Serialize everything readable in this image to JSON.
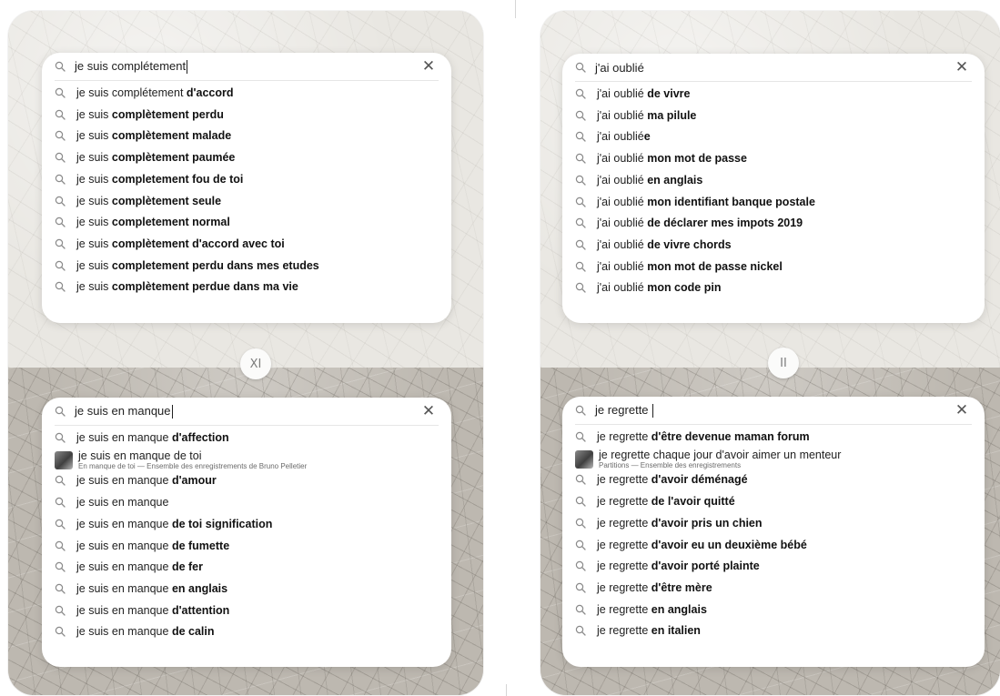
{
  "panels": [
    {
      "numeral": "XI",
      "top": {
        "query": "je suis complétement",
        "caret": true,
        "suggestions": [
          {
            "plain": "je suis complétement ",
            "bold": "d'accord"
          },
          {
            "plain": "je suis ",
            "bold": "complètement perdu"
          },
          {
            "plain": "je suis ",
            "bold": "complètement malade"
          },
          {
            "plain": "je suis ",
            "bold": "complètement paumée"
          },
          {
            "plain": "je suis ",
            "bold": "completement fou de toi"
          },
          {
            "plain": "je suis ",
            "bold": "complètement seule"
          },
          {
            "plain": "je suis ",
            "bold": "completement normal"
          },
          {
            "plain": "je suis ",
            "bold": "complètement d'accord avec toi"
          },
          {
            "plain": "je suis ",
            "bold": "completement perdu dans mes etudes"
          },
          {
            "plain": "je suis ",
            "bold": "complètement perdue dans ma vie"
          }
        ]
      },
      "bottom": {
        "query": "je suis en manque",
        "caret": true,
        "suggestions": [
          {
            "plain": "je suis en manque ",
            "bold": "d'affection"
          },
          {
            "rich": true,
            "title": "je suis en manque de toi",
            "subtitle": "En manque de toi — Ensemble des enregistrements de Bruno Pelletier"
          },
          {
            "plain": "je suis en manque ",
            "bold": "d'amour"
          },
          {
            "plain": "je suis en manque",
            "bold": ""
          },
          {
            "plain": "je suis en manque ",
            "bold": "de toi signification"
          },
          {
            "plain": "je suis en manque ",
            "bold": "de fumette"
          },
          {
            "plain": "je suis en manque ",
            "bold": "de fer"
          },
          {
            "plain": "je suis en manque ",
            "bold": "en anglais"
          },
          {
            "plain": "je suis en manque ",
            "bold": "d'attention"
          },
          {
            "plain": "je suis en manque ",
            "bold": "de calin"
          }
        ]
      }
    },
    {
      "numeral": "II",
      "top": {
        "query": "j'ai oublié",
        "caret": false,
        "suggestions": [
          {
            "plain": "j'ai oublié ",
            "bold": "de vivre"
          },
          {
            "plain": "j'ai oublié ",
            "bold": "ma pilule"
          },
          {
            "plain": "j'ai oublié",
            "bold": "e"
          },
          {
            "plain": "j'ai oublié ",
            "bold": "mon mot de passe"
          },
          {
            "plain": "j'ai oublié ",
            "bold": "en anglais"
          },
          {
            "plain": "j'ai oublié ",
            "bold": "mon identifiant banque postale"
          },
          {
            "plain": "j'ai oublié ",
            "bold": "de déclarer mes impots 2019"
          },
          {
            "plain": "j'ai oublié ",
            "bold": "de vivre chords"
          },
          {
            "plain": "j'ai oublié ",
            "bold": "mon mot de passe nickel"
          },
          {
            "plain": "j'ai oublié ",
            "bold": "mon code pin"
          }
        ]
      },
      "bottom": {
        "query": "je regrette ",
        "caret": true,
        "suggestions": [
          {
            "plain": "je regrette ",
            "bold": "d'être devenue maman forum"
          },
          {
            "rich": true,
            "title": "je regrette chaque jour d'avoir aimer un menteur",
            "subtitle": "Partitions — Ensemble des enregistrements"
          },
          {
            "plain": "je regrette ",
            "bold": "d'avoir déménagé"
          },
          {
            "plain": "je regrette ",
            "bold": "de l'avoir quitté"
          },
          {
            "plain": "je regrette ",
            "bold": "d'avoir pris un chien"
          },
          {
            "plain": "je regrette ",
            "bold": "d'avoir eu un deuxième bébé"
          },
          {
            "plain": "je regrette ",
            "bold": "d'avoir porté plainte"
          },
          {
            "plain": "je regrette ",
            "bold": "d'être mère"
          },
          {
            "plain": "je regrette ",
            "bold": "en anglais"
          },
          {
            "plain": "je regrette ",
            "bold": "en italien"
          }
        ]
      }
    }
  ],
  "icons": {
    "search": "search-icon",
    "clear": "close-icon",
    "thumbnail": "album-thumbnail"
  },
  "colors": {
    "background": "#ffffff",
    "box": "#ffffff",
    "text": "#1a1a1a",
    "icon": "#8a8a8a"
  }
}
